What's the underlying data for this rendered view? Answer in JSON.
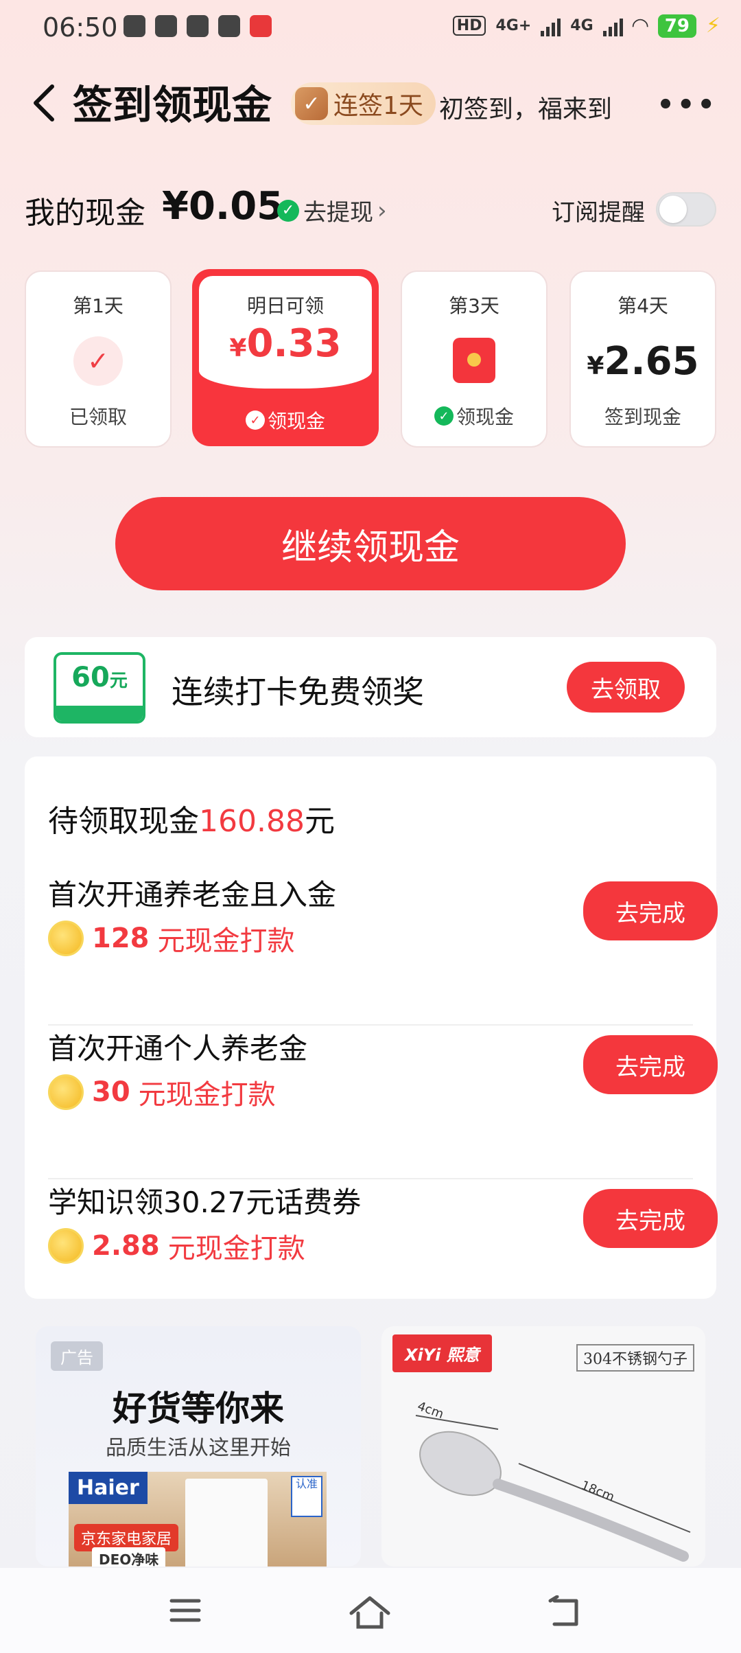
{
  "status": {
    "time": "06:50",
    "hd": "HD",
    "net1": "4G+",
    "net2": "4G",
    "battery": "79"
  },
  "header": {
    "title": "签到领现金",
    "badge": "连签1天",
    "slogan": "初签到，福来到",
    "more": "•••"
  },
  "cash": {
    "label": "我的现金",
    "amount": "¥0.05",
    "withdraw": "去提现",
    "subscribe_label": "订阅提醒"
  },
  "days": [
    {
      "label": "第1天",
      "status": "已领取"
    },
    {
      "label": "明日可领",
      "currency": "¥",
      "value": "0.33",
      "action": "领现金"
    },
    {
      "label": "第3天",
      "action": "领现金"
    },
    {
      "label": "第4天",
      "currency": "¥",
      "value": "2.65",
      "status": "签到现金"
    }
  ],
  "main_button": "继续领现金",
  "promo": {
    "ticket_value": "60",
    "ticket_unit": "元",
    "text": "连续打卡免费领奖",
    "button": "去领取"
  },
  "tasks": {
    "title_prefix": "待领取现金",
    "title_amount": "160.88",
    "title_suffix": "元",
    "items": [
      {
        "name": "首次开通养老金且入金",
        "reward_amount": "128",
        "reward_text": "元现金打款",
        "button": "去完成"
      },
      {
        "name": "首次开通个人养老金",
        "reward_amount": "30",
        "reward_text": "元现金打款",
        "button": "去完成"
      },
      {
        "name": "学知识领30.27元话费券",
        "reward_amount": "2.88",
        "reward_text": "元现金打款",
        "button": "去完成"
      }
    ]
  },
  "ads": [
    {
      "tag": "广告",
      "headline": "好货等你来",
      "sub": "品质生活从这里开始",
      "brand": "Haier",
      "store": "京东家电家居",
      "product": "DEO净味",
      "cert": "认准"
    },
    {
      "brand": "XiYi 熙意",
      "spec": "304不锈钢勺子",
      "len1": "4cm",
      "len2": "18cm"
    }
  ]
}
